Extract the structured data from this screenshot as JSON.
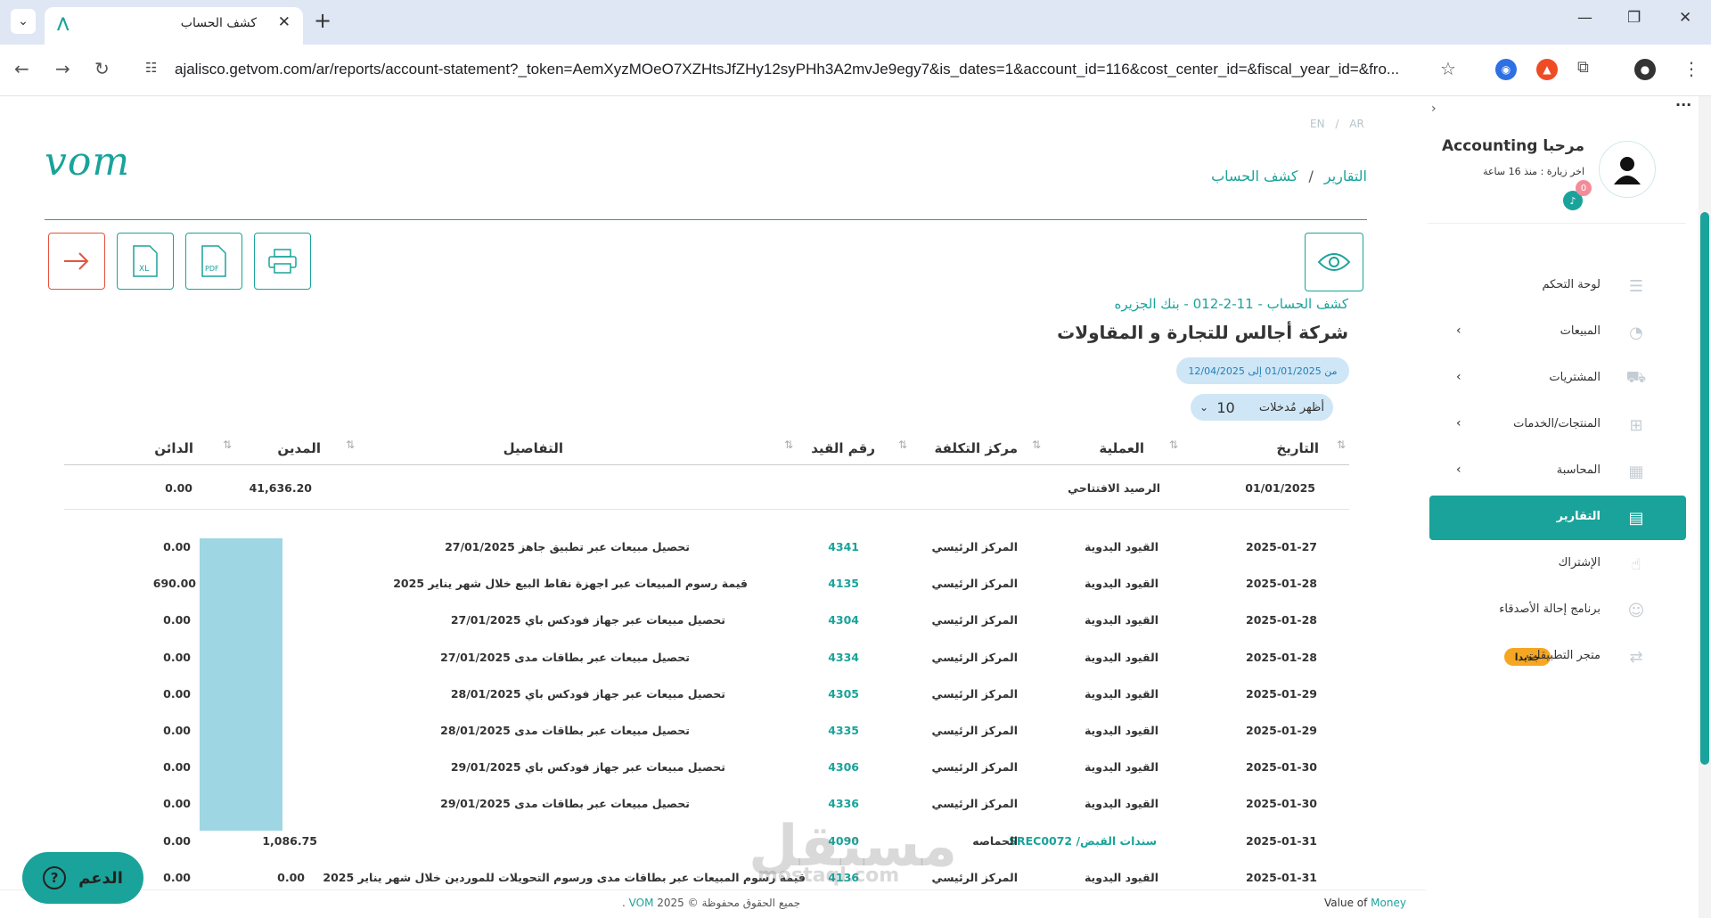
{
  "browser": {
    "tab_title": "كشف الحساب",
    "url": "ajalisco.getvom.com/ar/reports/account-statement?_token=AemXyzMOeO7XZHtsJfZHy12syPHh3A2mvJe9egy7&is_dates=1&account_id=116&cost_center_id=&fiscal_year_id=&fro..."
  },
  "page": {
    "lang_en": "EN",
    "lang_sep": "/",
    "lang_ar": "AR",
    "logo_text": "vom",
    "breadcrumb_reports": "التقارير",
    "breadcrumb_sep": "/",
    "breadcrumb_current": "كشف الحساب",
    "statement_subtitle": "كشف الحساب - 11-2-012 - بنك الجزيره",
    "company_name": "شركة أجالس للتجارة و المقاولات",
    "date_range": "من 01/01/2025 إلى 12/04/2025",
    "show_entries_label": "أظهر مُدخلات",
    "show_entries_value": "10",
    "pdf_label": "PDF",
    "xl_label": "XL"
  },
  "table": {
    "headers": {
      "date": "التاريخ",
      "operation": "العملية",
      "cost_center": "مركز التكلفة",
      "entry_no": "رقم القيد",
      "details": "التفاصيل",
      "debit": "المدين",
      "credit": "الدائن"
    },
    "opening": {
      "date": "01/01/2025",
      "label": "الرصيد الافتتاحي",
      "debit": "41,636.20",
      "credit": "0.00"
    },
    "rows": [
      {
        "date": "2025-01-27",
        "operation": "القيود اليدوية",
        "cost_center": "المركز الرئيسي",
        "entry_no": "4341",
        "details": "تحصيل مبيعات عبر تطبيق جاهز 27/01/2025",
        "debit": "",
        "credit": "0.00"
      },
      {
        "date": "2025-01-28",
        "operation": "القيود اليدوية",
        "cost_center": "المركز الرئيسي",
        "entry_no": "4135",
        "details": "قيمة رسوم المبيعات عبر اجهزة نقاط البيع خلال شهر يناير 2025",
        "debit": "",
        "credit": "690.00"
      },
      {
        "date": "2025-01-28",
        "operation": "القيود اليدوية",
        "cost_center": "المركز الرئيسي",
        "entry_no": "4304",
        "details": "تحصيل مبيعات عبر جهاز فودكس باي 27/01/2025",
        "debit": "",
        "credit": "0.00"
      },
      {
        "date": "2025-01-28",
        "operation": "القيود اليدوية",
        "cost_center": "المركز الرئيسي",
        "entry_no": "4334",
        "details": "تحصيل مبيعات عبر بطاقات مدى 27/01/2025",
        "debit": "",
        "credit": "0.00"
      },
      {
        "date": "2025-01-29",
        "operation": "القيود اليدوية",
        "cost_center": "المركز الرئيسي",
        "entry_no": "4305",
        "details": "تحصيل مبيعات عبر جهاز فودكس باي 28/01/2025",
        "debit": "",
        "credit": "0.00"
      },
      {
        "date": "2025-01-29",
        "operation": "القيود اليدوية",
        "cost_center": "المركز الرئيسي",
        "entry_no": "4335",
        "details": "تحصيل مبيعات عبر بطاقات مدى 28/01/2025",
        "debit": "",
        "credit": "0.00"
      },
      {
        "date": "2025-01-30",
        "operation": "القيود اليدوية",
        "cost_center": "المركز الرئيسي",
        "entry_no": "4306",
        "details": "تحصيل مبيعات عبر جهاز فودكس باي 29/01/2025",
        "debit": "",
        "credit": "0.00"
      },
      {
        "date": "2025-01-30",
        "operation": "القيود اليدوية",
        "cost_center": "المركز الرئيسي",
        "entry_no": "4336",
        "details": "تحصيل مبيعات عبر بطاقات مدى 29/01/2025",
        "debit": "",
        "credit": "0.00"
      },
      {
        "date": "2025-01-31",
        "operation": "سندات القبض/ SREC0072",
        "cost_center": "الحماصه",
        "entry_no": "4090",
        "details": "",
        "debit": "1,086.75",
        "credit": "0.00"
      },
      {
        "date": "2025-01-31",
        "operation": "القيود اليدوية",
        "cost_center": "المركز الرئيسي",
        "entry_no": "4136",
        "details": "قيمة رسوم المبيعات عبر بطاقات مدى ورسوم التحويلات للموردين خلال شهر يناير 2025",
        "debit": "0.00",
        "credit": "0.00"
      }
    ]
  },
  "sidebar": {
    "welcome": "مرحبا Accounting",
    "last_visit": "اخر زيارة : منذ 16 ساعة",
    "notif_count": "0",
    "items": [
      {
        "label": "لوحة التحكم"
      },
      {
        "label": "المبيعات"
      },
      {
        "label": "المشتريات"
      },
      {
        "label": "المنتجات/الخدمات"
      },
      {
        "label": "المحاسبة"
      },
      {
        "label": "التقارير"
      },
      {
        "label": "الإشتراك"
      },
      {
        "label": "برنامج إحالة الأصدقاء"
      },
      {
        "label": "متجر التطبيقات",
        "badge": "جديدا"
      }
    ]
  },
  "footer": {
    "rights": "جميع الحقوق محفوظة © 2025",
    "brand": "VOM",
    "dot": ".",
    "value_of": "Value of",
    "money": "Money"
  },
  "support_label": "الدعم",
  "watermark": "مستقل",
  "watermark_sub": "mostaql.com",
  "colors": {
    "accent": "#1aa39a",
    "export_red": "#e5533c",
    "date_pill": "#cfe6f6",
    "badge_orange": "#f5a623"
  }
}
